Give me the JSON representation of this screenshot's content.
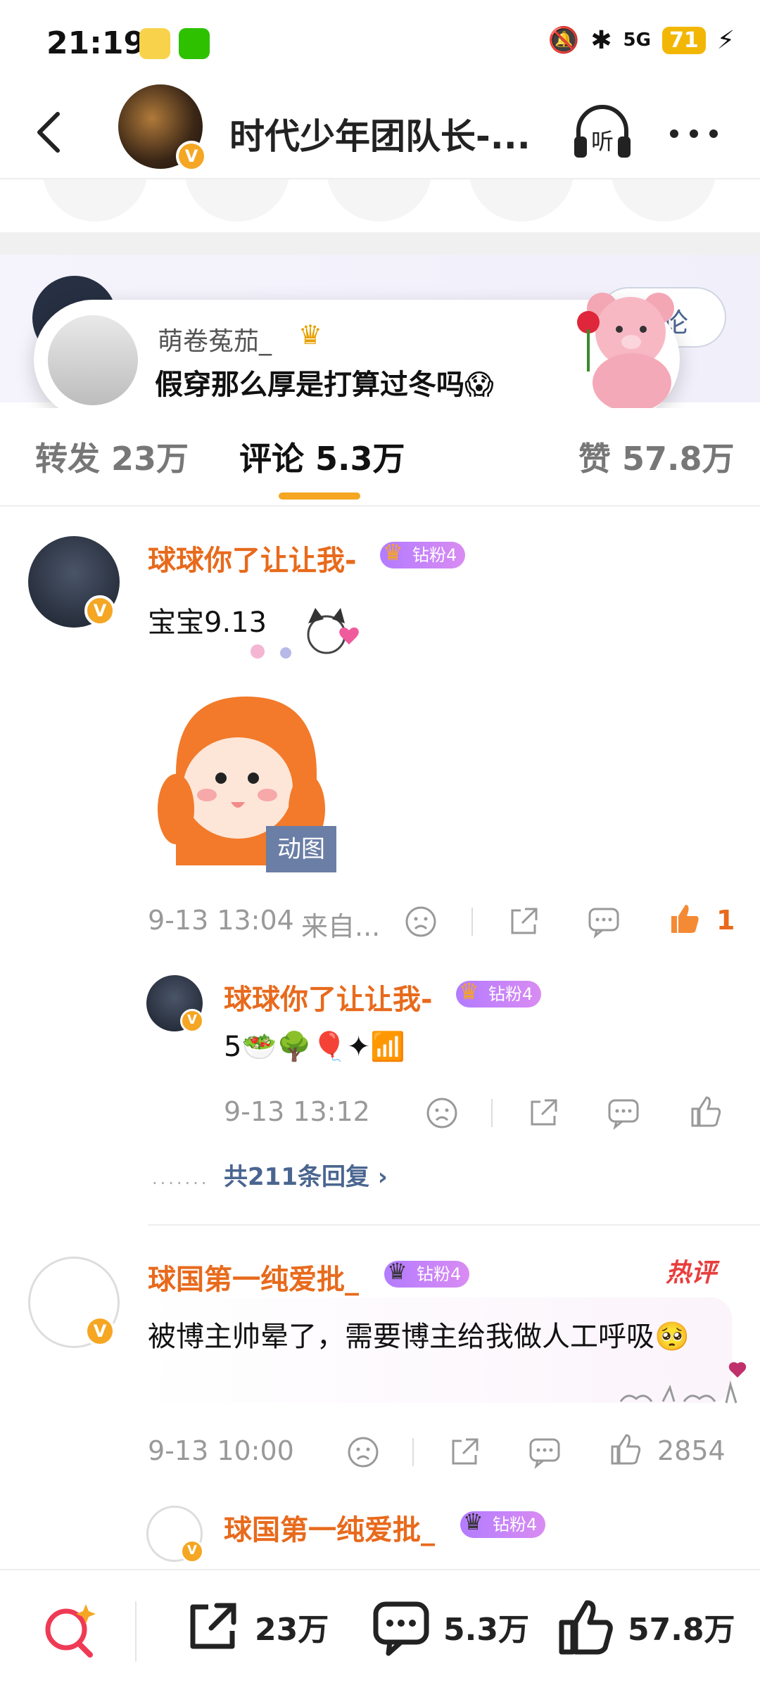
{
  "status_bar": {
    "time": "21:19",
    "signal": "5G",
    "battery": "71"
  },
  "header": {
    "title": "时代少年团队长-..."
  },
  "comment_box": {
    "button_label": "论"
  },
  "popup": {
    "username": "萌卷菟茄_",
    "text": "假穿那么厚是打算过冬吗😱"
  },
  "tabs": [
    {
      "label": "转发 23万"
    },
    {
      "label": "评论 5.3万"
    },
    {
      "label": "赞 57.8万"
    }
  ],
  "comments": [
    {
      "username": "球球你了让让我-",
      "badge": "钻粉4",
      "text": "宝宝9.13",
      "gif_label": "动图",
      "time": "9-13 13:04",
      "source": "来自...",
      "likes": "1",
      "reply": {
        "username": "球球你了让让我-",
        "badge": "钻粉4",
        "text": "5🥗🌳🎈✦📶",
        "time": "9-13 13:12"
      },
      "more_replies": "共211条回复 ›"
    },
    {
      "username": "球国第一纯爱批_",
      "badge": "钻粉4",
      "hot_tag": "热评",
      "text": "被博主帅晕了，需要博主给我做人工呼吸🥺",
      "time": "9-13 10:00",
      "likes": "2854",
      "reply": {
        "username": "球国第一纯爱批_",
        "badge": "钻粉4"
      }
    }
  ],
  "bottom_bar": {
    "reposts": "23万",
    "comments": "5.3万",
    "likes": "57.8万"
  }
}
